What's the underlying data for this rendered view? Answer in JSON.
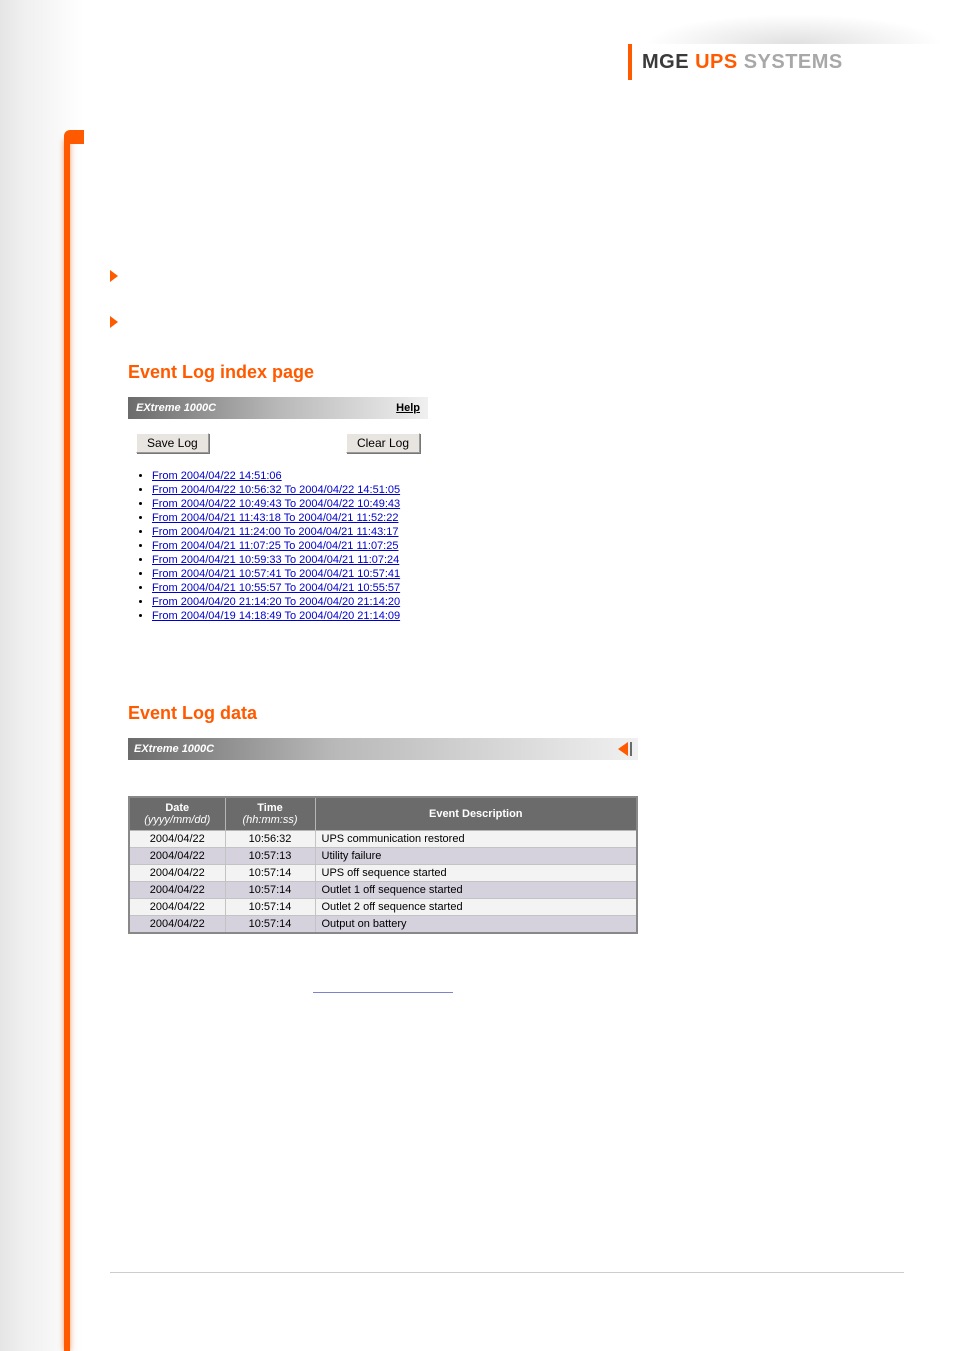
{
  "brand": {
    "part1": "MGE",
    "part2": "UPS",
    "part3": "SYSTEMS"
  },
  "sections": {
    "index_title": "Event Log index page",
    "data_title": "Event Log data"
  },
  "panel1": {
    "device": "EXtreme 1000C",
    "help": "Help",
    "save_label": "Save Log",
    "clear_label": "Clear Log",
    "links": [
      "From 2004/04/22 14:51:06",
      "From 2004/04/22 10:56:32 To 2004/04/22 14:51:05",
      "From 2004/04/22 10:49:43 To 2004/04/22 10:49:43",
      "From 2004/04/21 11:43:18 To 2004/04/21 11:52:22",
      "From 2004/04/21 11:24:00 To 2004/04/21 11:43:17",
      "From 2004/04/21 11:07:25 To 2004/04/21 11:07:25",
      "From 2004/04/21 10:59:33 To 2004/04/21 11:07:24",
      "From 2004/04/21 10:57:41 To 2004/04/21 10:57:41",
      "From 2004/04/21 10:55:57 To 2004/04/21 10:55:57",
      "From 2004/04/20 21:14:20 To 2004/04/20 21:14:20",
      "From 2004/04/19 14:18:49 To 2004/04/20 21:14:09"
    ]
  },
  "panel2": {
    "device": "EXtreme 1000C",
    "columns": {
      "date": "Date",
      "date_fmt": "(yyyy/mm/dd)",
      "time": "Time",
      "time_fmt": "(hh:mm:ss)",
      "desc": "Event Description"
    },
    "rows": [
      {
        "date": "2004/04/22",
        "time": "10:56:32",
        "desc": "UPS communication restored"
      },
      {
        "date": "2004/04/22",
        "time": "10:57:13",
        "desc": "Utility failure"
      },
      {
        "date": "2004/04/22",
        "time": "10:57:14",
        "desc": "UPS off sequence started"
      },
      {
        "date": "2004/04/22",
        "time": "10:57:14",
        "desc": "Outlet 1 off sequence started"
      },
      {
        "date": "2004/04/22",
        "time": "10:57:14",
        "desc": "Outlet 2 off sequence started"
      },
      {
        "date": "2004/04/22",
        "time": "10:57:14",
        "desc": "Output on battery"
      }
    ]
  }
}
